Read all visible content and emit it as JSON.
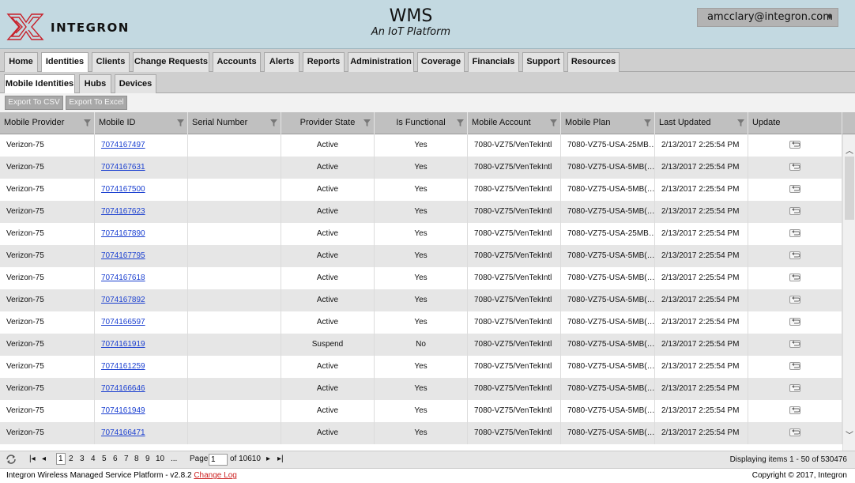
{
  "header": {
    "logo_text": "INTEGRON",
    "title": "WMS",
    "subtitle": "An IoT Platform",
    "user": "amcclary@integron.com"
  },
  "tabs": [
    {
      "label": "Home"
    },
    {
      "label": "Identities",
      "active": true
    },
    {
      "label": "Clients"
    },
    {
      "label": "Change Requests"
    },
    {
      "label": "Accounts"
    },
    {
      "label": "Alerts"
    },
    {
      "label": "Reports"
    },
    {
      "label": "Administration"
    },
    {
      "label": "Coverage"
    },
    {
      "label": "Financials"
    },
    {
      "label": "Support"
    },
    {
      "label": "Resources"
    }
  ],
  "subtabs": [
    {
      "label": "Mobile Identities",
      "active": true
    },
    {
      "label": "Hubs"
    },
    {
      "label": "Devices"
    }
  ],
  "toolbar": {
    "export_csv": "Export To CSV",
    "export_excel": "Export To Excel"
  },
  "columns": [
    "Mobile Provider",
    "Mobile ID",
    "Serial Number",
    "Provider State",
    "Is Functional",
    "Mobile Account",
    "Mobile Plan",
    "Last Updated",
    "Update"
  ],
  "rows": [
    [
      "Verizon-75",
      "7074167497",
      "",
      "Active",
      "Yes",
      "7080-VZ75/VenTekIntl",
      "7080-VZ75-USA-25MB…",
      "2/13/2017 2:25:54 PM"
    ],
    [
      "Verizon-75",
      "7074167631",
      "",
      "Active",
      "Yes",
      "7080-VZ75/VenTekIntl",
      "7080-VZ75-USA-5MB(…",
      "2/13/2017 2:25:54 PM"
    ],
    [
      "Verizon-75",
      "7074167500",
      "",
      "Active",
      "Yes",
      "7080-VZ75/VenTekIntl",
      "7080-VZ75-USA-5MB(…",
      "2/13/2017 2:25:54 PM"
    ],
    [
      "Verizon-75",
      "7074167623",
      "",
      "Active",
      "Yes",
      "7080-VZ75/VenTekIntl",
      "7080-VZ75-USA-5MB(…",
      "2/13/2017 2:25:54 PM"
    ],
    [
      "Verizon-75",
      "7074167890",
      "",
      "Active",
      "Yes",
      "7080-VZ75/VenTekIntl",
      "7080-VZ75-USA-25MB…",
      "2/13/2017 2:25:54 PM"
    ],
    [
      "Verizon-75",
      "7074167795",
      "",
      "Active",
      "Yes",
      "7080-VZ75/VenTekIntl",
      "7080-VZ75-USA-5MB(…",
      "2/13/2017 2:25:54 PM"
    ],
    [
      "Verizon-75",
      "7074167618",
      "",
      "Active",
      "Yes",
      "7080-VZ75/VenTekIntl",
      "7080-VZ75-USA-5MB(…",
      "2/13/2017 2:25:54 PM"
    ],
    [
      "Verizon-75",
      "7074167892",
      "",
      "Active",
      "Yes",
      "7080-VZ75/VenTekIntl",
      "7080-VZ75-USA-5MB(…",
      "2/13/2017 2:25:54 PM"
    ],
    [
      "Verizon-75",
      "7074166597",
      "",
      "Active",
      "Yes",
      "7080-VZ75/VenTekIntl",
      "7080-VZ75-USA-5MB(…",
      "2/13/2017 2:25:54 PM"
    ],
    [
      "Verizon-75",
      "7074161919",
      "",
      "Suspend",
      "No",
      "7080-VZ75/VenTekIntl",
      "7080-VZ75-USA-5MB(…",
      "2/13/2017 2:25:54 PM"
    ],
    [
      "Verizon-75",
      "7074161259",
      "",
      "Active",
      "Yes",
      "7080-VZ75/VenTekIntl",
      "7080-VZ75-USA-5MB(…",
      "2/13/2017 2:25:54 PM"
    ],
    [
      "Verizon-75",
      "7074166646",
      "",
      "Active",
      "Yes",
      "7080-VZ75/VenTekIntl",
      "7080-VZ75-USA-5MB(…",
      "2/13/2017 2:25:54 PM"
    ],
    [
      "Verizon-75",
      "7074161949",
      "",
      "Active",
      "Yes",
      "7080-VZ75/VenTekIntl",
      "7080-VZ75-USA-5MB(…",
      "2/13/2017 2:25:54 PM"
    ],
    [
      "Verizon-75",
      "7074166471",
      "",
      "Active",
      "Yes",
      "7080-VZ75/VenTekIntl",
      "7080-VZ75-USA-5MB(…",
      "2/13/2017 2:25:54 PM"
    ]
  ],
  "pager": {
    "pages": [
      "1",
      "2",
      "3",
      "4",
      "5",
      "6",
      "7",
      "8",
      "9",
      "10",
      "..."
    ],
    "page_label": "Page",
    "page_value": "1",
    "of_label": "of 10610",
    "info": "Displaying items 1 - 50 of 530476"
  },
  "footer": {
    "platform": "Integron Wireless Managed Service Platform - v2.8.2",
    "change_log": "Change Log",
    "copyright": "Copyright © 2017, Integron"
  },
  "icons": {
    "refresh": "refresh-icon",
    "filter": "filter-icon",
    "update": "undo-icon"
  },
  "colors": {
    "header_bg": "#c3d9e1",
    "link": "#1a3fd0",
    "logo_red": "#c8202a"
  }
}
